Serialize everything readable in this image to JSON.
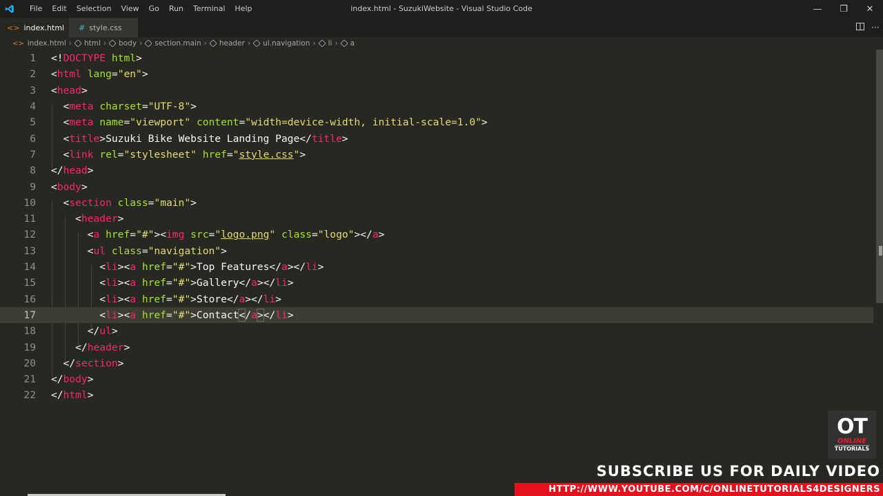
{
  "app": {
    "window_title": "index.html - SuzukiWebsite - Visual Studio Code",
    "menu": [
      "File",
      "Edit",
      "Selection",
      "View",
      "Go",
      "Run",
      "Terminal",
      "Help"
    ],
    "window_controls": {
      "minimize": "—",
      "restore": "❐",
      "close": "✕"
    }
  },
  "tabs": [
    {
      "label": "index.html",
      "icon": "html-icon",
      "active": true,
      "close": "✕"
    },
    {
      "label": "style.css",
      "icon": "css-hash-icon",
      "active": false
    }
  ],
  "tab_actions": {
    "split": "split-editor-icon",
    "more": "···"
  },
  "breadcrumb": [
    "index.html",
    "html",
    "body",
    "section.main",
    "header",
    "ul.navigation",
    "li",
    "a"
  ],
  "editor": {
    "theme_colors": {
      "background": "#272822",
      "tag": "#f92672",
      "attribute": "#a6e22e",
      "string": "#e6db74",
      "text": "#f8f8f2"
    },
    "current_line": 17,
    "lines": [
      {
        "n": "1",
        "c": [
          [
            "p",
            "<!"
          ],
          [
            "t",
            "DOCTYPE"
          ],
          [
            "p",
            " "
          ],
          [
            "a",
            "html"
          ],
          [
            "p",
            ">"
          ]
        ]
      },
      {
        "n": "2",
        "c": [
          [
            "p",
            "<"
          ],
          [
            "t",
            "html"
          ],
          [
            "p",
            " "
          ],
          [
            "a",
            "lang"
          ],
          [
            "p",
            "="
          ],
          [
            "s",
            "\"en\""
          ],
          [
            "p",
            ">"
          ]
        ]
      },
      {
        "n": "3",
        "c": [
          [
            "p",
            "<"
          ],
          [
            "t",
            "head"
          ],
          [
            "p",
            ">"
          ]
        ]
      },
      {
        "n": "4",
        "c": [
          [
            "p",
            "  <"
          ],
          [
            "t",
            "meta"
          ],
          [
            "p",
            " "
          ],
          [
            "a",
            "charset"
          ],
          [
            "p",
            "="
          ],
          [
            "s",
            "\"UTF-8\""
          ],
          [
            "p",
            ">"
          ]
        ]
      },
      {
        "n": "5",
        "c": [
          [
            "p",
            "  <"
          ],
          [
            "t",
            "meta"
          ],
          [
            "p",
            " "
          ],
          [
            "a",
            "name"
          ],
          [
            "p",
            "="
          ],
          [
            "s",
            "\"viewport\""
          ],
          [
            "p",
            " "
          ],
          [
            "a",
            "content"
          ],
          [
            "p",
            "="
          ],
          [
            "s",
            "\"width=device-width, initial-scale=1.0\""
          ],
          [
            "p",
            ">"
          ]
        ]
      },
      {
        "n": "6",
        "c": [
          [
            "p",
            "  <"
          ],
          [
            "t",
            "title"
          ],
          [
            "p",
            ">Suzuki Bike Website Landing Page</"
          ],
          [
            "t",
            "title"
          ],
          [
            "p",
            ">"
          ]
        ]
      },
      {
        "n": "7",
        "c": [
          [
            "p",
            "  <"
          ],
          [
            "t",
            "link"
          ],
          [
            "p",
            " "
          ],
          [
            "a",
            "rel"
          ],
          [
            "p",
            "="
          ],
          [
            "s",
            "\"stylesheet\""
          ],
          [
            "p",
            " "
          ],
          [
            "a",
            "href"
          ],
          [
            "p",
            "="
          ],
          [
            "s",
            "\""
          ],
          [
            "su",
            "style.css"
          ],
          [
            "s",
            "\""
          ],
          [
            "p",
            ">"
          ]
        ]
      },
      {
        "n": "8",
        "c": [
          [
            "p",
            "</"
          ],
          [
            "t",
            "head"
          ],
          [
            "p",
            ">"
          ]
        ]
      },
      {
        "n": "9",
        "c": [
          [
            "p",
            "<"
          ],
          [
            "t",
            "body"
          ],
          [
            "p",
            ">"
          ]
        ]
      },
      {
        "n": "10",
        "c": [
          [
            "p",
            "  <"
          ],
          [
            "t",
            "section"
          ],
          [
            "p",
            " "
          ],
          [
            "a",
            "class"
          ],
          [
            "p",
            "="
          ],
          [
            "s",
            "\"main\""
          ],
          [
            "p",
            ">"
          ]
        ]
      },
      {
        "n": "11",
        "c": [
          [
            "p",
            "    <"
          ],
          [
            "t",
            "header"
          ],
          [
            "p",
            ">"
          ]
        ]
      },
      {
        "n": "12",
        "c": [
          [
            "p",
            "      <"
          ],
          [
            "t",
            "a"
          ],
          [
            "p",
            " "
          ],
          [
            "a",
            "href"
          ],
          [
            "p",
            "="
          ],
          [
            "s",
            "\"#\""
          ],
          [
            "p",
            "><"
          ],
          [
            "t",
            "img"
          ],
          [
            "p",
            " "
          ],
          [
            "a",
            "src"
          ],
          [
            "p",
            "="
          ],
          [
            "s",
            "\""
          ],
          [
            "su",
            "logo.png"
          ],
          [
            "s",
            "\""
          ],
          [
            "p",
            " "
          ],
          [
            "a",
            "class"
          ],
          [
            "p",
            "="
          ],
          [
            "s",
            "\"logo\""
          ],
          [
            "p",
            "></"
          ],
          [
            "t",
            "a"
          ],
          [
            "p",
            ">"
          ]
        ]
      },
      {
        "n": "13",
        "c": [
          [
            "p",
            "      <"
          ],
          [
            "t",
            "ul"
          ],
          [
            "p",
            " "
          ],
          [
            "a",
            "class"
          ],
          [
            "p",
            "="
          ],
          [
            "s",
            "\"navigation\""
          ],
          [
            "p",
            ">"
          ]
        ]
      },
      {
        "n": "14",
        "c": [
          [
            "p",
            "        <"
          ],
          [
            "t",
            "li"
          ],
          [
            "p",
            "><"
          ],
          [
            "t",
            "a"
          ],
          [
            "p",
            " "
          ],
          [
            "a",
            "href"
          ],
          [
            "p",
            "="
          ],
          [
            "s",
            "\"#\""
          ],
          [
            "p",
            ">Top Features</"
          ],
          [
            "t",
            "a"
          ],
          [
            "p",
            "></"
          ],
          [
            "t",
            "li"
          ],
          [
            "p",
            ">"
          ]
        ]
      },
      {
        "n": "15",
        "c": [
          [
            "p",
            "        <"
          ],
          [
            "t",
            "li"
          ],
          [
            "p",
            "><"
          ],
          [
            "t",
            "a"
          ],
          [
            "p",
            " "
          ],
          [
            "a",
            "href"
          ],
          [
            "p",
            "="
          ],
          [
            "s",
            "\"#\""
          ],
          [
            "p",
            ">Gallery</"
          ],
          [
            "t",
            "a"
          ],
          [
            "p",
            "></"
          ],
          [
            "t",
            "li"
          ],
          [
            "p",
            ">"
          ]
        ]
      },
      {
        "n": "16",
        "c": [
          [
            "p",
            "        <"
          ],
          [
            "t",
            "li"
          ],
          [
            "p",
            "><"
          ],
          [
            "t",
            "a"
          ],
          [
            "p",
            " "
          ],
          [
            "a",
            "href"
          ],
          [
            "p",
            "="
          ],
          [
            "s",
            "\"#\""
          ],
          [
            "p",
            ">Store</"
          ],
          [
            "t",
            "a"
          ],
          [
            "p",
            "></"
          ],
          [
            "t",
            "li"
          ],
          [
            "p",
            ">"
          ]
        ]
      },
      {
        "n": "17",
        "c": [
          [
            "p",
            "        <"
          ],
          [
            "t",
            "li"
          ],
          [
            "p",
            "><"
          ],
          [
            "t",
            "a"
          ],
          [
            "p",
            " "
          ],
          [
            "a",
            "href"
          ],
          [
            "p",
            "="
          ],
          [
            "s",
            "\"#\""
          ],
          [
            "p",
            ">Contact"
          ],
          [
            "cursor",
            ""
          ],
          [
            "pb",
            "<"
          ],
          [
            "p",
            "/"
          ],
          [
            "t",
            "a"
          ],
          [
            "pb",
            ">"
          ],
          [
            "p",
            "</"
          ],
          [
            "t",
            "li"
          ],
          [
            "p",
            ">"
          ]
        ]
      },
      {
        "n": "18",
        "c": [
          [
            "p",
            "      </"
          ],
          [
            "t",
            "ul"
          ],
          [
            "p",
            ">"
          ]
        ]
      },
      {
        "n": "19",
        "c": [
          [
            "p",
            "    </"
          ],
          [
            "t",
            "header"
          ],
          [
            "p",
            ">"
          ]
        ]
      },
      {
        "n": "20",
        "c": [
          [
            "p",
            "  </"
          ],
          [
            "t",
            "section"
          ],
          [
            "p",
            ">"
          ]
        ]
      },
      {
        "n": "21",
        "c": [
          [
            "p",
            "</"
          ],
          [
            "t",
            "body"
          ],
          [
            "p",
            ">"
          ]
        ]
      },
      {
        "n": "22",
        "c": [
          [
            "p",
            "</"
          ],
          [
            "t",
            "html"
          ],
          [
            "p",
            ">"
          ]
        ]
      }
    ]
  },
  "overlay": {
    "logo_big": "OT",
    "logo_online": "ONLINE",
    "logo_tutorials": "TUTORIALS",
    "subscribe": "SUBSCRIBE US FOR DAILY VIDEO",
    "url": "HTTP://WWW.YOUTUBE.COM/C/ONLINETUTORIALS4DESIGNERS"
  }
}
